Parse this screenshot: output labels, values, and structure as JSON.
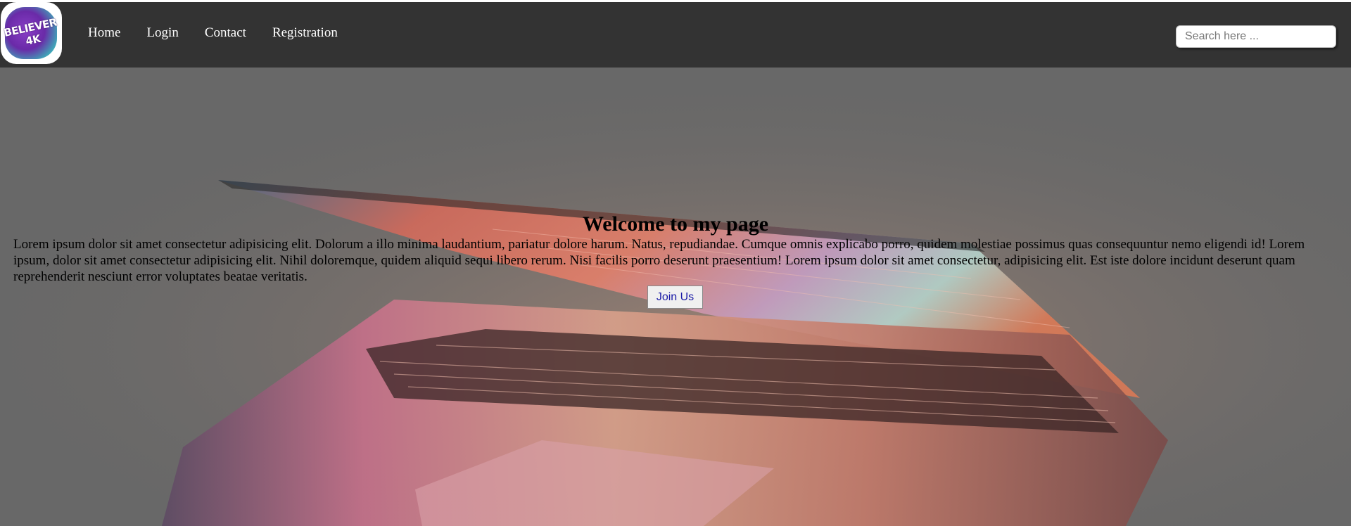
{
  "logo": {
    "text": "BELIEVER 4K"
  },
  "nav": {
    "items": [
      {
        "label": "Home"
      },
      {
        "label": "Login"
      },
      {
        "label": "Contact"
      },
      {
        "label": "Registration"
      }
    ]
  },
  "search": {
    "placeholder": "Search here ...",
    "value": ""
  },
  "hero": {
    "title": "Welcome to my page",
    "body": "Lorem ipsum dolor sit amet consectetur adipisicing elit. Dolorum a illo minima laudantium, pariatur dolore harum. Natus, repudiandae. Cumque omnis explicabo porro, quidem molestiae possimus quas consequuntur nemo eligendi id! Lorem ipsum, dolor sit amet consectetur adipisicing elit. Nihil doloremque, quidem aliquid sequi libero rerum. Nisi facilis porro deserunt praesentium! Lorem ipsum dolor sit amet consectetur, adipisicing elit. Est iste dolore incidunt deserunt quam reprehenderit nesciunt error voluptates beatae veritatis.",
    "button_label": "Join Us",
    "background_image": "laptop-keyboard-photo"
  },
  "colors": {
    "navbar": "#333333",
    "hero_overlay": "#6a6a6a",
    "button_text": "#1a1aa6"
  }
}
